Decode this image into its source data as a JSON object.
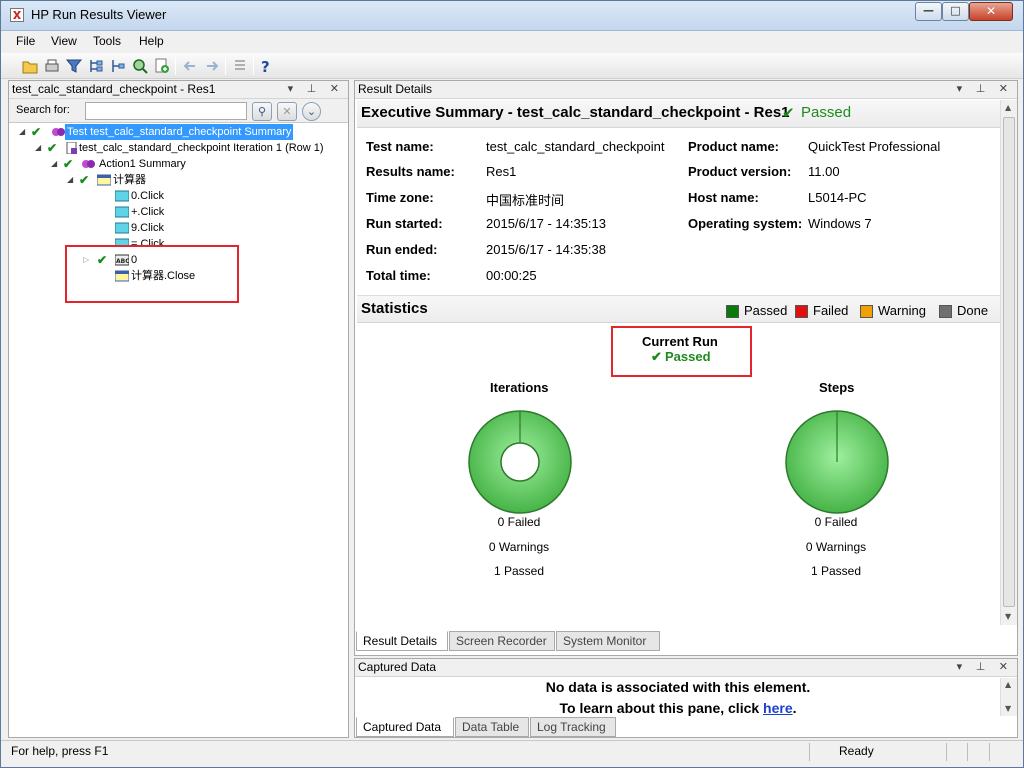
{
  "window": {
    "title": "HP Run Results Viewer"
  },
  "menu": [
    "File",
    "View",
    "Tools",
    "Help"
  ],
  "left_pane": {
    "title": "test_calc_standard_checkpoint - Res1",
    "search_label": "Search for:",
    "search_value": "",
    "tree": {
      "root": "Test test_calc_standard_checkpoint Summary",
      "iteration": "test_calc_standard_checkpoint Iteration 1 (Row 1)",
      "action": "Action1 Summary",
      "window_node": "计算器",
      "steps": [
        "0.Click",
        "+.Click",
        "9.Click",
        "=.Click"
      ],
      "checkpoint": "0",
      "close_step": "计算器.Close"
    }
  },
  "result_pane": {
    "title": "Result Details",
    "summary_title": "Executive Summary - test_calc_standard_checkpoint - Res1",
    "summary_status": "Passed",
    "labels": {
      "test_name": "Test name:",
      "results_name": "Results name:",
      "time_zone": "Time zone:",
      "run_started": "Run started:",
      "run_ended": "Run ended:",
      "total_time": "Total time:",
      "product_name": "Product name:",
      "product_version": "Product version:",
      "host_name": "Host name:",
      "operating_system": "Operating system:"
    },
    "values": {
      "test_name": "test_calc_standard_checkpoint",
      "results_name": "Res1",
      "time_zone": "中国标准时间",
      "run_started": "2015/6/17 - 14:35:13",
      "run_ended": "2015/6/17 - 14:35:38",
      "total_time": "00:00:25",
      "product_name": "QuickTest Professional",
      "product_version": "11.00",
      "host_name": "L5014-PC",
      "operating_system": "Windows 7"
    },
    "statistics": {
      "title": "Statistics",
      "legend": [
        {
          "label": "Passed",
          "color": "#0a7a0a"
        },
        {
          "label": "Failed",
          "color": "#e01010"
        },
        {
          "label": "Warning",
          "color": "#f0a000"
        },
        {
          "label": "Done",
          "color": "#707070"
        }
      ],
      "current_run_label": "Current Run",
      "current_run_status": "Passed",
      "iterations": {
        "title": "Iterations",
        "failed": "0 Failed",
        "warnings": "0 Warnings",
        "passed": "1 Passed"
      },
      "steps": {
        "title": "Steps",
        "failed": "0 Failed",
        "warnings": "0 Warnings",
        "passed": "1 Passed"
      }
    },
    "tabs": [
      "Result Details",
      "Screen Recorder",
      "System Monitor"
    ]
  },
  "captured_pane": {
    "title": "Captured Data",
    "message1": "No data is associated with this element.",
    "message2_prefix": "To learn about this pane, click ",
    "message2_link": "here",
    "tabs": [
      "Captured Data",
      "Data Table",
      "Log Tracking"
    ]
  },
  "statusbar": {
    "help": "For help, press F1",
    "state": "Ready"
  },
  "colors": {
    "passed": "#1d8b1d",
    "selection": "#3399ff",
    "highlight_box": "#e3262b",
    "pie_green": "#5fcf5f"
  }
}
